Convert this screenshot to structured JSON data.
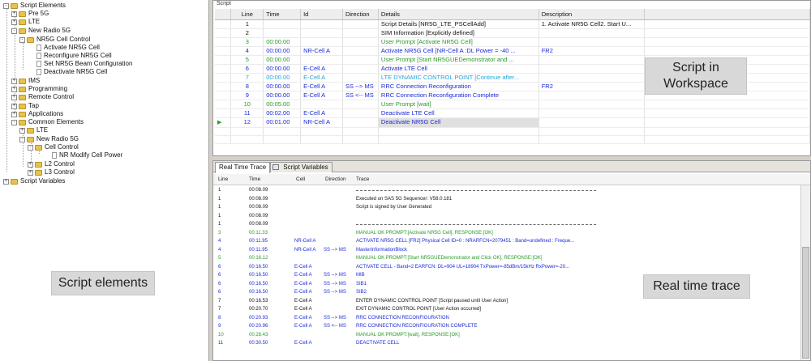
{
  "tree": {
    "root": "Script Elements",
    "items": [
      {
        "label": "Pre 5G"
      },
      {
        "label": "LTE"
      },
      {
        "label": "New Radio 5G"
      },
      {
        "label": "NR5G Cell Control"
      },
      {
        "label": "Activate NR5G Cell"
      },
      {
        "label": "Reconfigure NR5G Cell"
      },
      {
        "label": "Set NR5G Beam Configuration"
      },
      {
        "label": "Deactivate NR5G Cell"
      },
      {
        "label": "IMS"
      },
      {
        "label": "Programming"
      },
      {
        "label": "Remote Control"
      },
      {
        "label": "Tap"
      },
      {
        "label": "Applications"
      },
      {
        "label": "Common Elements"
      },
      {
        "label": "LTE"
      },
      {
        "label": "New Radio 5G"
      },
      {
        "label": "Cell Control"
      },
      {
        "label": "NR Modify Cell Power"
      },
      {
        "label": "L2 Control"
      },
      {
        "label": "L3 Control"
      },
      {
        "label": "Script Variables"
      }
    ]
  },
  "labels": {
    "script_elements": "Script elements",
    "script_in_workspace_1": "Script in",
    "script_in_workspace_2": "Workspace",
    "real_time_trace": "Real time trace"
  },
  "script": {
    "title": "Script",
    "headers": [
      "Line",
      "Time",
      "Id",
      "Direction",
      "Details",
      "Description"
    ],
    "rows": [
      {
        "line": "1",
        "time": "",
        "id": "",
        "dir": "",
        "details": "Script Details [NR5G_LTE_PSCellAdd]",
        "desc": "1. Activate NR5G Cell2. Start U...",
        "color": "dark"
      },
      {
        "line": "2",
        "time": "",
        "id": "",
        "dir": "",
        "details": "SIM Information [Explicitly defined]",
        "desc": "",
        "color": "dark"
      },
      {
        "line": "3",
        "time": "00:00.00",
        "id": "",
        "dir": "",
        "details": "User Prompt [Activate NR5G Cell]",
        "desc": "",
        "color": "green"
      },
      {
        "line": "4",
        "time": "00:00.00",
        "id": "NR-Cell A",
        "dir": "",
        "details": "Activate NR5G Cell [NR-Cell A :DL Power = -40 ...",
        "desc": "FR2",
        "color": "blue"
      },
      {
        "line": "5",
        "time": "00:00.00",
        "id": "",
        "dir": "",
        "details": "User Prompt [Start NR5GUEDemonstrator and ...",
        "desc": "",
        "color": "green"
      },
      {
        "line": "6",
        "time": "00:00.00",
        "id": "E-Cell A",
        "dir": "",
        "details": "Activate LTE Cell",
        "desc": "",
        "color": "blue"
      },
      {
        "line": "7",
        "time": "00:00.00",
        "id": "E-Cell A",
        "dir": "",
        "details": "LTE DYNAMIC CONTROL POINT [Continue after...",
        "desc": "",
        "color": "cyan"
      },
      {
        "line": "8",
        "time": "00:00.00",
        "id": "E-Cell A",
        "dir": "SS --> MS",
        "details": "RRC Connection Reconfiguration",
        "desc": "FR2",
        "color": "blue"
      },
      {
        "line": "9",
        "time": "00:00.00",
        "id": "E-Cell A",
        "dir": "SS <-- MS",
        "details": "RRC Connection Reconfiguration Complete",
        "desc": "",
        "color": "blue"
      },
      {
        "line": "10",
        "time": "00:05.00",
        "id": "",
        "dir": "",
        "details": "User Prompt [wait]",
        "desc": "",
        "color": "green"
      },
      {
        "line": "11",
        "time": "00:02.00",
        "id": "E-Cell A",
        "dir": "",
        "details": "Deactivate LTE Cell",
        "desc": "",
        "color": "blue"
      },
      {
        "line": "12",
        "time": "00:01.00",
        "id": "NR-Cell A",
        "dir": "",
        "details": "Deactivate NR5G Cell",
        "desc": "",
        "color": "blue"
      }
    ]
  },
  "trace": {
    "tabs": [
      "Real Time Trace",
      "Script Variables"
    ],
    "headers": [
      "Line",
      "Time",
      "Cell",
      "Direction",
      "Trace"
    ],
    "rows": [
      {
        "line": "1",
        "time": "00:08.09",
        "cell": "",
        "dir": "",
        "text": "",
        "color": "dark",
        "sep": true
      },
      {
        "line": "1",
        "time": "00:08.09",
        "cell": "",
        "dir": "",
        "text": "Executed on SAS 5G Sequencer: V58.0.181",
        "color": "dark"
      },
      {
        "line": "1",
        "time": "00:08.09",
        "cell": "",
        "dir": "",
        "text": "Script is signed by User Generated",
        "color": "dark"
      },
      {
        "line": "1",
        "time": "00:08.09",
        "cell": "",
        "dir": "",
        "text": "",
        "color": "dark"
      },
      {
        "line": "1",
        "time": "00:08.09",
        "cell": "",
        "dir": "",
        "text": "",
        "color": "dark",
        "sep": true
      },
      {
        "line": "3",
        "time": "00:11.33",
        "cell": "",
        "dir": "",
        "text": "MANUAL OK PROMPT:[Activate NR5G Cell], RESPONSE:[OK]",
        "color": "green"
      },
      {
        "line": "4",
        "time": "00:11.95",
        "cell": "NR-Cell A",
        "dir": "",
        "text": "ACTIVATE NR5G CELL [FR2]  Physical Cell ID=0 : NRARFCN=2079451 : Band=undefined : Freque...",
        "color": "blue"
      },
      {
        "line": "4",
        "time": "00:11.95",
        "cell": "NR-Cell A",
        "dir": "SS --> MS",
        "text": "MasterInformationBlock",
        "color": "blue"
      },
      {
        "line": "5",
        "time": "00:16.12",
        "cell": "",
        "dir": "",
        "text": "MANUAL OK PROMPT:[Start NR5GUEDemonstrator and Click OK], RESPONSE:[OK]",
        "color": "green"
      },
      {
        "line": "6",
        "time": "00:16.50",
        "cell": "E-Cell A",
        "dir": "",
        "text": "ACTIVATE CELL - Band=2  EARFCN: DL=904 UL=18904  TxPower=-85dBm/15kHz  RxPower=-20...",
        "color": "blue"
      },
      {
        "line": "6",
        "time": "00:16.50",
        "cell": "E-Cell A",
        "dir": "SS --> MS",
        "text": "MIB",
        "color": "blue"
      },
      {
        "line": "6",
        "time": "00:16.50",
        "cell": "E-Cell A",
        "dir": "SS --> MS",
        "text": "SIB1",
        "color": "blue"
      },
      {
        "line": "6",
        "time": "00:16.50",
        "cell": "E-Cell A",
        "dir": "SS --> MS",
        "text": "SIB2",
        "color": "blue"
      },
      {
        "line": "7",
        "time": "00:16.53",
        "cell": "E-Cell A",
        "dir": "",
        "text": "ENTER DYNAMIC CONTROL POINT [Script paused until User Action]",
        "color": "dark"
      },
      {
        "line": "7",
        "time": "00:20.70",
        "cell": "E-Cell A",
        "dir": "",
        "text": "EXIT DYNAMIC CONTROL POINT [User Action occurred]",
        "color": "dark"
      },
      {
        "line": "8",
        "time": "00:20.93",
        "cell": "E-Cell A",
        "dir": "SS --> MS",
        "text": "RRC CONNECTION RECONFIGURATION",
        "color": "blue"
      },
      {
        "line": "9",
        "time": "00:20.96",
        "cell": "E-Cell A",
        "dir": "SS <-- MS",
        "text": "RRC CONNECTION RECONFIGURATION COMPLETE",
        "color": "blue"
      },
      {
        "line": "10",
        "time": "00:28.43",
        "cell": "",
        "dir": "",
        "text": "MANUAL OK PROMPT:[wait], RESPONSE:[OK]",
        "color": "green"
      },
      {
        "line": "11",
        "time": "00:30.50",
        "cell": "E-Cell A",
        "dir": "",
        "text": "DEACTIVATE CELL",
        "color": "blue"
      }
    ]
  },
  "colors": {
    "green": "#2a9a2a",
    "blue": "#1a2ad8",
    "cyan": "#22a6d8",
    "folder": "#e8c24a"
  }
}
